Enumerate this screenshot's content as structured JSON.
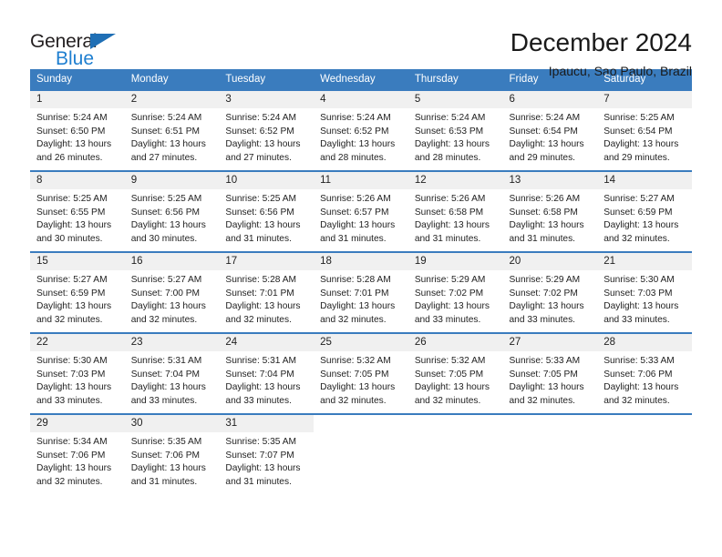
{
  "logo": {
    "text_primary": "General",
    "text_secondary": "Blue",
    "triangle_icon": "triangle-icon",
    "primary_color": "#231f20",
    "secondary_color": "#1f7fd0"
  },
  "header": {
    "title": "December 2024",
    "subtitle": "Ipaucu, Sao Paulo, Brazil"
  },
  "theme": {
    "header_row_bg": "#3a7cbe",
    "header_row_text": "#ffffff",
    "daynum_bg": "#f0f0f0",
    "body_text": "#222222"
  },
  "weekdays": [
    "Sunday",
    "Monday",
    "Tuesday",
    "Wednesday",
    "Thursday",
    "Friday",
    "Saturday"
  ],
  "labels": {
    "sunrise_prefix": "Sunrise:",
    "sunset_prefix": "Sunset:",
    "daylight_prefix": "Daylight:"
  },
  "weeks": [
    [
      {
        "day": "1",
        "sunrise": "Sunrise: 5:24 AM",
        "sunset": "Sunset: 6:50 PM",
        "daylight_line1": "Daylight: 13 hours",
        "daylight_line2": "and 26 minutes."
      },
      {
        "day": "2",
        "sunrise": "Sunrise: 5:24 AM",
        "sunset": "Sunset: 6:51 PM",
        "daylight_line1": "Daylight: 13 hours",
        "daylight_line2": "and 27 minutes."
      },
      {
        "day": "3",
        "sunrise": "Sunrise: 5:24 AM",
        "sunset": "Sunset: 6:52 PM",
        "daylight_line1": "Daylight: 13 hours",
        "daylight_line2": "and 27 minutes."
      },
      {
        "day": "4",
        "sunrise": "Sunrise: 5:24 AM",
        "sunset": "Sunset: 6:52 PM",
        "daylight_line1": "Daylight: 13 hours",
        "daylight_line2": "and 28 minutes."
      },
      {
        "day": "5",
        "sunrise": "Sunrise: 5:24 AM",
        "sunset": "Sunset: 6:53 PM",
        "daylight_line1": "Daylight: 13 hours",
        "daylight_line2": "and 28 minutes."
      },
      {
        "day": "6",
        "sunrise": "Sunrise: 5:24 AM",
        "sunset": "Sunset: 6:54 PM",
        "daylight_line1": "Daylight: 13 hours",
        "daylight_line2": "and 29 minutes."
      },
      {
        "day": "7",
        "sunrise": "Sunrise: 5:25 AM",
        "sunset": "Sunset: 6:54 PM",
        "daylight_line1": "Daylight: 13 hours",
        "daylight_line2": "and 29 minutes."
      }
    ],
    [
      {
        "day": "8",
        "sunrise": "Sunrise: 5:25 AM",
        "sunset": "Sunset: 6:55 PM",
        "daylight_line1": "Daylight: 13 hours",
        "daylight_line2": "and 30 minutes."
      },
      {
        "day": "9",
        "sunrise": "Sunrise: 5:25 AM",
        "sunset": "Sunset: 6:56 PM",
        "daylight_line1": "Daylight: 13 hours",
        "daylight_line2": "and 30 minutes."
      },
      {
        "day": "10",
        "sunrise": "Sunrise: 5:25 AM",
        "sunset": "Sunset: 6:56 PM",
        "daylight_line1": "Daylight: 13 hours",
        "daylight_line2": "and 31 minutes."
      },
      {
        "day": "11",
        "sunrise": "Sunrise: 5:26 AM",
        "sunset": "Sunset: 6:57 PM",
        "daylight_line1": "Daylight: 13 hours",
        "daylight_line2": "and 31 minutes."
      },
      {
        "day": "12",
        "sunrise": "Sunrise: 5:26 AM",
        "sunset": "Sunset: 6:58 PM",
        "daylight_line1": "Daylight: 13 hours",
        "daylight_line2": "and 31 minutes."
      },
      {
        "day": "13",
        "sunrise": "Sunrise: 5:26 AM",
        "sunset": "Sunset: 6:58 PM",
        "daylight_line1": "Daylight: 13 hours",
        "daylight_line2": "and 31 minutes."
      },
      {
        "day": "14",
        "sunrise": "Sunrise: 5:27 AM",
        "sunset": "Sunset: 6:59 PM",
        "daylight_line1": "Daylight: 13 hours",
        "daylight_line2": "and 32 minutes."
      }
    ],
    [
      {
        "day": "15",
        "sunrise": "Sunrise: 5:27 AM",
        "sunset": "Sunset: 6:59 PM",
        "daylight_line1": "Daylight: 13 hours",
        "daylight_line2": "and 32 minutes."
      },
      {
        "day": "16",
        "sunrise": "Sunrise: 5:27 AM",
        "sunset": "Sunset: 7:00 PM",
        "daylight_line1": "Daylight: 13 hours",
        "daylight_line2": "and 32 minutes."
      },
      {
        "day": "17",
        "sunrise": "Sunrise: 5:28 AM",
        "sunset": "Sunset: 7:01 PM",
        "daylight_line1": "Daylight: 13 hours",
        "daylight_line2": "and 32 minutes."
      },
      {
        "day": "18",
        "sunrise": "Sunrise: 5:28 AM",
        "sunset": "Sunset: 7:01 PM",
        "daylight_line1": "Daylight: 13 hours",
        "daylight_line2": "and 32 minutes."
      },
      {
        "day": "19",
        "sunrise": "Sunrise: 5:29 AM",
        "sunset": "Sunset: 7:02 PM",
        "daylight_line1": "Daylight: 13 hours",
        "daylight_line2": "and 33 minutes."
      },
      {
        "day": "20",
        "sunrise": "Sunrise: 5:29 AM",
        "sunset": "Sunset: 7:02 PM",
        "daylight_line1": "Daylight: 13 hours",
        "daylight_line2": "and 33 minutes."
      },
      {
        "day": "21",
        "sunrise": "Sunrise: 5:30 AM",
        "sunset": "Sunset: 7:03 PM",
        "daylight_line1": "Daylight: 13 hours",
        "daylight_line2": "and 33 minutes."
      }
    ],
    [
      {
        "day": "22",
        "sunrise": "Sunrise: 5:30 AM",
        "sunset": "Sunset: 7:03 PM",
        "daylight_line1": "Daylight: 13 hours",
        "daylight_line2": "and 33 minutes."
      },
      {
        "day": "23",
        "sunrise": "Sunrise: 5:31 AM",
        "sunset": "Sunset: 7:04 PM",
        "daylight_line1": "Daylight: 13 hours",
        "daylight_line2": "and 33 minutes."
      },
      {
        "day": "24",
        "sunrise": "Sunrise: 5:31 AM",
        "sunset": "Sunset: 7:04 PM",
        "daylight_line1": "Daylight: 13 hours",
        "daylight_line2": "and 33 minutes."
      },
      {
        "day": "25",
        "sunrise": "Sunrise: 5:32 AM",
        "sunset": "Sunset: 7:05 PM",
        "daylight_line1": "Daylight: 13 hours",
        "daylight_line2": "and 32 minutes."
      },
      {
        "day": "26",
        "sunrise": "Sunrise: 5:32 AM",
        "sunset": "Sunset: 7:05 PM",
        "daylight_line1": "Daylight: 13 hours",
        "daylight_line2": "and 32 minutes."
      },
      {
        "day": "27",
        "sunrise": "Sunrise: 5:33 AM",
        "sunset": "Sunset: 7:05 PM",
        "daylight_line1": "Daylight: 13 hours",
        "daylight_line2": "and 32 minutes."
      },
      {
        "day": "28",
        "sunrise": "Sunrise: 5:33 AM",
        "sunset": "Sunset: 7:06 PM",
        "daylight_line1": "Daylight: 13 hours",
        "daylight_line2": "and 32 minutes."
      }
    ],
    [
      {
        "day": "29",
        "sunrise": "Sunrise: 5:34 AM",
        "sunset": "Sunset: 7:06 PM",
        "daylight_line1": "Daylight: 13 hours",
        "daylight_line2": "and 32 minutes."
      },
      {
        "day": "30",
        "sunrise": "Sunrise: 5:35 AM",
        "sunset": "Sunset: 7:06 PM",
        "daylight_line1": "Daylight: 13 hours",
        "daylight_line2": "and 31 minutes."
      },
      {
        "day": "31",
        "sunrise": "Sunrise: 5:35 AM",
        "sunset": "Sunset: 7:07 PM",
        "daylight_line1": "Daylight: 13 hours",
        "daylight_line2": "and 31 minutes."
      },
      {
        "day": "",
        "sunrise": "",
        "sunset": "",
        "daylight_line1": "",
        "daylight_line2": ""
      },
      {
        "day": "",
        "sunrise": "",
        "sunset": "",
        "daylight_line1": "",
        "daylight_line2": ""
      },
      {
        "day": "",
        "sunrise": "",
        "sunset": "",
        "daylight_line1": "",
        "daylight_line2": ""
      },
      {
        "day": "",
        "sunrise": "",
        "sunset": "",
        "daylight_line1": "",
        "daylight_line2": ""
      }
    ]
  ]
}
